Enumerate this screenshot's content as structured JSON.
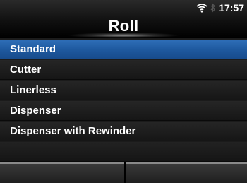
{
  "header": {
    "title": "Roll",
    "time": "17:57",
    "icons": [
      "wifi-icon",
      "bluetooth-icon"
    ]
  },
  "menu": {
    "items": [
      {
        "label": "Standard",
        "selected": true
      },
      {
        "label": "Cutter",
        "selected": false
      },
      {
        "label": "Linerless",
        "selected": false
      },
      {
        "label": "Dispenser",
        "selected": false
      },
      {
        "label": "Dispenser with Rewinder",
        "selected": false
      }
    ]
  },
  "softkeys": {
    "left": "",
    "right": ""
  },
  "colors": {
    "selection": "#1f5aa0",
    "background": "#1b1b1b",
    "text": "#ffffff"
  }
}
